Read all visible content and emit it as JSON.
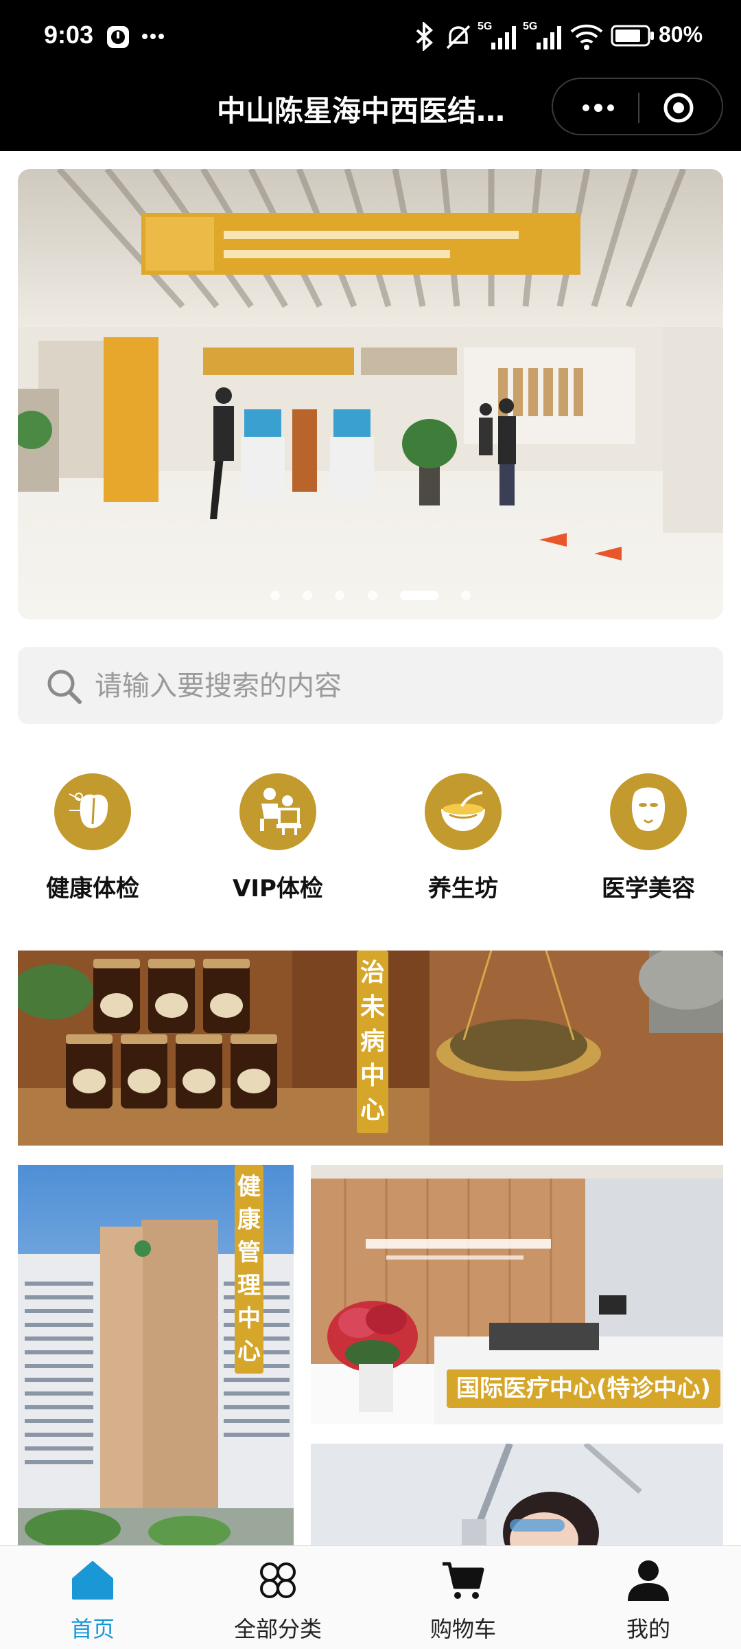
{
  "status_bar": {
    "time": "9:03",
    "network_1": "5G",
    "network_2": "5G",
    "battery": "80%"
  },
  "title_bar": {
    "title": "中山陈星海中西医结…"
  },
  "search": {
    "placeholder": "请输入要搜索的内容"
  },
  "categories": [
    {
      "label": "健康体检",
      "icon": "physical-exam-icon"
    },
    {
      "label": "VIP体检",
      "icon": "vip-checkup-icon"
    },
    {
      "label": "养生坊",
      "icon": "soup-bowl-icon"
    },
    {
      "label": "医学美容",
      "icon": "face-mask-icon"
    }
  ],
  "banner": {
    "dot_count": 6,
    "active_dot": 5
  },
  "tiles": {
    "tile1_label": "治未病中心",
    "tile2_label": "健康管理中心",
    "tile3_label": "国际医疗中心(特诊中心)"
  },
  "bottom_nav": [
    {
      "label": "首页",
      "icon": "home-icon",
      "active": true
    },
    {
      "label": "全部分类",
      "icon": "all-categories-icon",
      "active": false
    },
    {
      "label": "购物车",
      "icon": "shopping-cart-icon",
      "active": false
    },
    {
      "label": "我的",
      "icon": "profile-icon",
      "active": false
    }
  ],
  "colors": {
    "accent_gold": "#c39a2e",
    "label_gold": "#d6a62b",
    "nav_active": "#1a98d6"
  }
}
